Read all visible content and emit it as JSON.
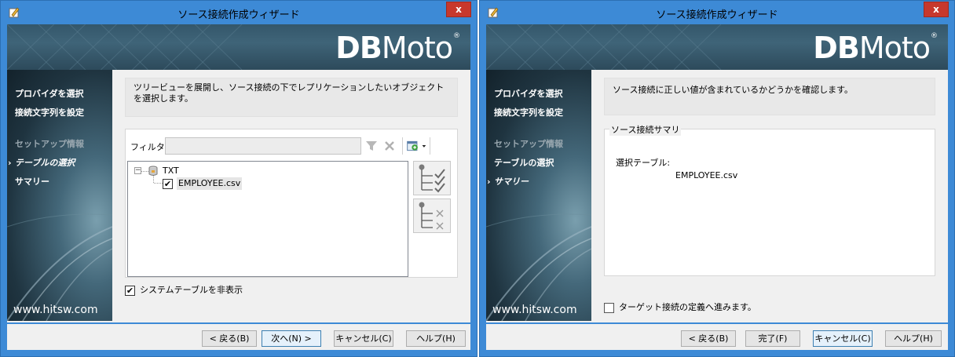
{
  "left": {
    "title": "ソース接続作成ウィザード",
    "close": "x",
    "logo": {
      "bold": "DB",
      "rest": "Moto",
      "reg": "®"
    },
    "steps": [
      {
        "label": "プロバイダを選択",
        "state": "normal"
      },
      {
        "label": "接続文字列を設定",
        "state": "normal"
      },
      {
        "label": "セットアップ情報",
        "state": "done"
      },
      {
        "label": "テーブルの選択",
        "state": "active"
      },
      {
        "label": "サマリー",
        "state": "normal"
      }
    ],
    "website": "www.hitsw.com",
    "description": "ツリービューを展開し、ソース接続の下でレプリケーションしたいオブジェクトを選択します。",
    "filter_label": "フィルタ:",
    "filter_value": "",
    "tree": {
      "root_label": "TXT",
      "root_expander": "−",
      "child_label": "EMPLOYEE.csv",
      "child_checked": true
    },
    "hide_system_label": "システムテーブルを非表示",
    "hide_system_checked": true,
    "buttons": {
      "back": "< 戻る(B)",
      "next": "次へ(N) >",
      "cancel": "キャンセル(C)",
      "help": "ヘルプ(H)"
    }
  },
  "right": {
    "title": "ソース接続作成ウィザード",
    "close": "x",
    "logo": {
      "bold": "DB",
      "rest": "Moto",
      "reg": "®"
    },
    "steps": [
      {
        "label": "プロバイダを選択",
        "state": "normal"
      },
      {
        "label": "接続文字列を設定",
        "state": "normal"
      },
      {
        "label": "セットアップ情報",
        "state": "done"
      },
      {
        "label": "テーブルの選択",
        "state": "normal"
      },
      {
        "label": "サマリー",
        "state": "active"
      }
    ],
    "website": "www.hitsw.com",
    "description": "ソース接続に正しい値が含まれているかどうかを確認します。",
    "summary_title": "ソース接続サマリ",
    "selected_tables_label": "選択テーブル:",
    "selected_tables_value": "EMPLOYEE.csv",
    "proceed_label": "ターゲット接続の定義へ進みます。",
    "proceed_checked": false,
    "buttons": {
      "back": "< 戻る(B)",
      "finish": "完了(F)",
      "cancel": "キャンセル(C)",
      "help": "ヘルプ(H)"
    }
  },
  "colors": {
    "titlebar": "#3d8ad6",
    "close": "#c7382c",
    "banner": "#3f6478"
  },
  "check_mark": "✔"
}
